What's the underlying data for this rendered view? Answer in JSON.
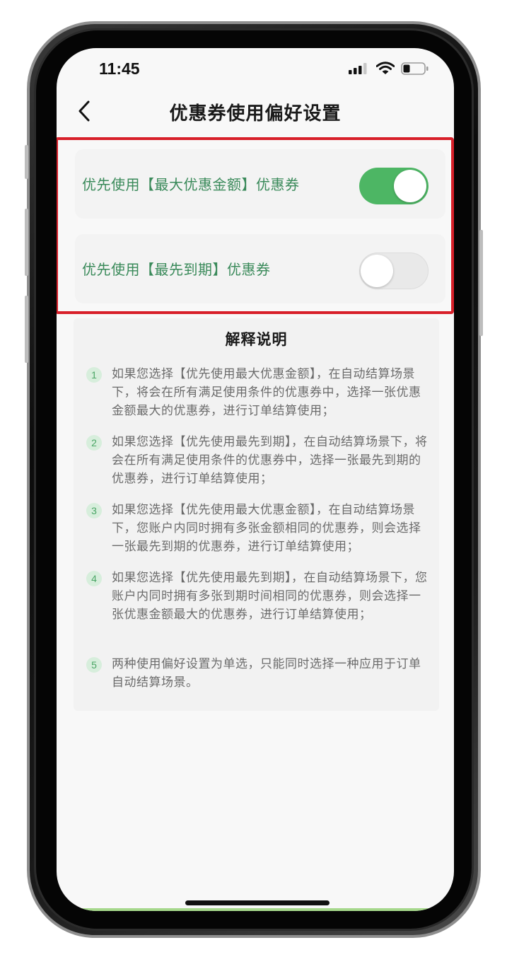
{
  "status_bar": {
    "time": "11:45"
  },
  "nav": {
    "title": "优惠券使用偏好设置"
  },
  "preferences": [
    {
      "label": "优先使用【最大优惠金额】优惠券",
      "enabled": true
    },
    {
      "label": "优先使用【最先到期】优惠券",
      "enabled": false
    }
  ],
  "explanation": {
    "title": "解释说明",
    "items": [
      {
        "num": "1",
        "text": "如果您选择【优先使用最大优惠金额】，在自动结算场景下，将会在所有满足使用条件的优惠券中，选择一张优惠金额最大的优惠券，进行订单结算使用；"
      },
      {
        "num": "2",
        "text": "如果您选择【优先使用最先到期】，在自动结算场景下，将会在所有满足使用条件的优惠券中，选择一张最先到期的优惠券，进行订单结算使用；"
      },
      {
        "num": "3",
        "text": "如果您选择【优先使用最大优惠金额】，在自动结算场景下，您账户内同时拥有多张金额相同的优惠券，则会选择一张最先到期的优惠券，进行订单结算使用；"
      },
      {
        "num": "4",
        "text": "如果您选择【优先使用最先到期】，在自动结算场景下，您账户内同时拥有多张到期时间相同的优惠券，则会选择一张优惠金额最大的优惠券，进行订单结算使用；"
      },
      {
        "num": "5",
        "text": "两种使用偏好设置为单选，只能同时选择一种应用于订单自动结算场景。"
      }
    ]
  },
  "colors": {
    "accent_green": "#4db664",
    "label_green": "#3a8a5a",
    "highlight_red": "#d8202a"
  },
  "icons": {
    "back": "chevron-left-icon",
    "signal": "signal-icon",
    "wifi": "wifi-icon",
    "battery": "battery-icon"
  }
}
